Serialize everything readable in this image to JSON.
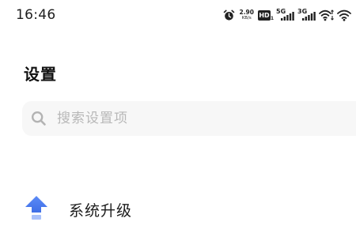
{
  "status_bar": {
    "time": "16:46",
    "net_speed_value": "2.90",
    "net_speed_unit": "KB/s",
    "icons": [
      "alarm-icon",
      "net-speed",
      "hd-icon",
      "signal-5g-icon",
      "signal-3g-icon",
      "wifi-data-icon",
      "wifi-icon"
    ],
    "hd_label": "HD",
    "hd_sub": "1",
    "gen1_label": "5G",
    "gen2_label": "3G"
  },
  "page": {
    "title": "设置"
  },
  "search": {
    "placeholder": "搜索设置项",
    "value": "",
    "icon": "search-icon"
  },
  "settings_items": [
    {
      "label": "系统升级",
      "icon": "system-update-arrow-icon",
      "icon_color": "#4a7bf0"
    }
  ],
  "colors": {
    "background": "#ffffff",
    "search_background": "#f7f7f7",
    "placeholder": "#b8b8b8",
    "accent_blue": "#4a7bf0"
  }
}
